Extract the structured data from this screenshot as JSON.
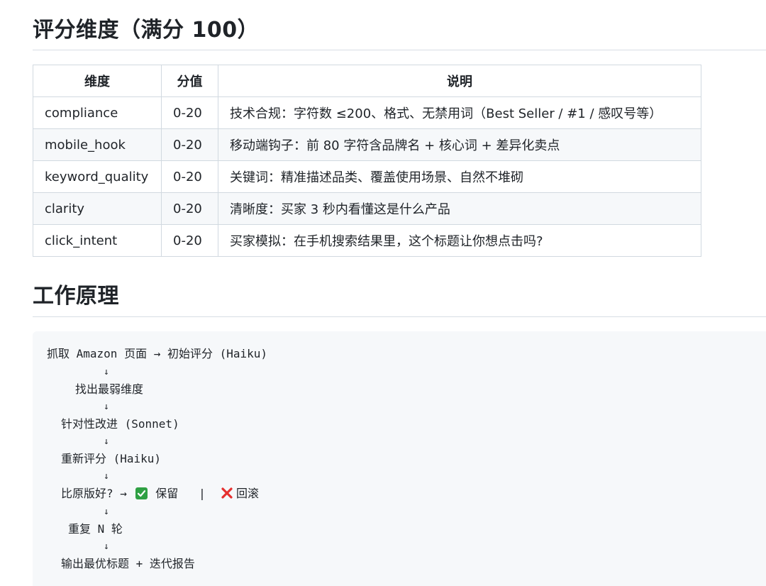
{
  "scoring": {
    "heading": "评分维度（满分 100）",
    "columns": [
      "维度",
      "分值",
      "说明"
    ],
    "rows": [
      {
        "dimension": "compliance",
        "score": "0-20",
        "desc": "技术合规：字符数 ≤200、格式、无禁用词（Best Seller / #1 / 感叹号等）"
      },
      {
        "dimension": "mobile_hook",
        "score": "0-20",
        "desc": "移动端钩子：前 80 字符含品牌名 + 核心词 + 差异化卖点"
      },
      {
        "dimension": "keyword_quality",
        "score": "0-20",
        "desc": "关键词：精准描述品类、覆盖使用场景、自然不堆砌"
      },
      {
        "dimension": "clarity",
        "score": "0-20",
        "desc": "清晰度：买家 3 秒内看懂这是什么产品"
      },
      {
        "dimension": "click_intent",
        "score": "0-20",
        "desc": "买家模拟：在手机搜索结果里，这个标题让你想点击吗?"
      }
    ]
  },
  "workflow": {
    "heading": "工作原理",
    "arrow": "↓",
    "steps": [
      "抓取 Amazon 页面 → 初始评分 (Haiku)",
      "找出最弱维度",
      "针对性改进 (Sonnet)",
      "重新评分 (Haiku)",
      "比原版好? → ",
      "重复 N 轮",
      "输出最优标题 + 迭代报告"
    ],
    "keep_label": "保留",
    "separator": "|",
    "rollback_label": "回滚",
    "icons": {
      "keep": "check-mark-icon",
      "rollback": "cross-mark-icon"
    },
    "colors": {
      "check_bg": "#2ea043",
      "cross": "#e5302e"
    }
  }
}
